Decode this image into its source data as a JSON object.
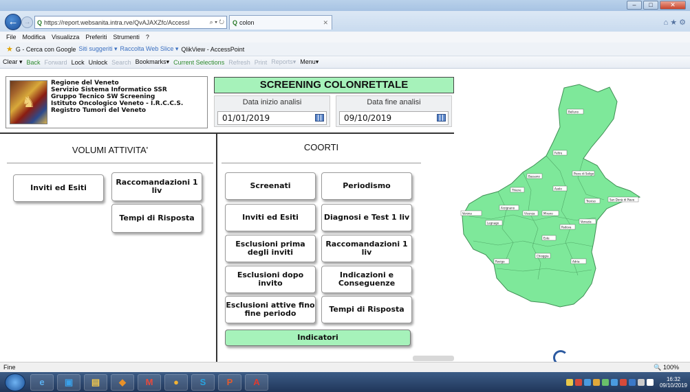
{
  "browser": {
    "url": "https://report.websanita.intra.rve/QvAJAXZfc/AccessI",
    "tab_title": "colon",
    "menu": [
      "File",
      "Modifica",
      "Visualizza",
      "Preferiti",
      "Strumenti",
      "?"
    ],
    "favorites": [
      "G - Cerca con Google",
      "Siti suggeriti ▾",
      "Raccolta Web Slice ▾",
      "QlikView - AccessPoint"
    ],
    "toolbar": [
      "Clear ▾",
      "Back",
      "Forward",
      "Lock",
      "Unlock",
      "Search",
      "Bookmarks▾",
      "Current Selections",
      "Refresh",
      "Print",
      "Reports▾",
      "Menu▾"
    ],
    "status": "Fine",
    "zoom": "100%"
  },
  "header": {
    "org_lines": [
      "Regione del Veneto",
      "Servizio Sistema Informatico SSR",
      "Gruppo Tecnico SW Screening",
      "Istituto Oncologico Veneto - I.R.C.C.S.",
      "Registro Tumori del Veneto"
    ],
    "title": "SCREENING COLONRETTALE",
    "start_label": "Data inizio analisi",
    "start_value": "01/01/2019",
    "end_label": "Data fine analisi",
    "end_value": "09/10/2019"
  },
  "volumi": {
    "title": "VOLUMI ATTIVITA'",
    "buttons": [
      "Inviti ed Esiti",
      "Raccomandazioni 1 liv",
      "Tempi di Risposta"
    ]
  },
  "coorti": {
    "title": "COORTI",
    "buttons": [
      "Screenati",
      "Periodismo",
      "Inviti ed Esiti",
      "Diagnosi e Test 1 liv",
      "Esclusioni prima degli inviti",
      "Raccomandazioni 1 liv",
      "Esclusioni dopo invito",
      "Indicazioni e Conseguenze",
      "Esclusioni attive fino fine periodo",
      "Tempi di Risposta"
    ],
    "indicatori": "Indicatori"
  },
  "map_labels": [
    "Belluno",
    "Feltre",
    "Asolo",
    "Treviso",
    "Bassano",
    "Padova",
    "Vicenza",
    "Verona",
    "Legnago",
    "Este",
    "Rovigo",
    "Adria",
    "Chioggia",
    "Venezia",
    "Mirano",
    "San Donà di Piave",
    "Pieve di Soligo",
    "Thiene",
    "Arzignano"
  ],
  "taskbar": {
    "clock_time": "16:32",
    "clock_date": "09/10/2019"
  }
}
